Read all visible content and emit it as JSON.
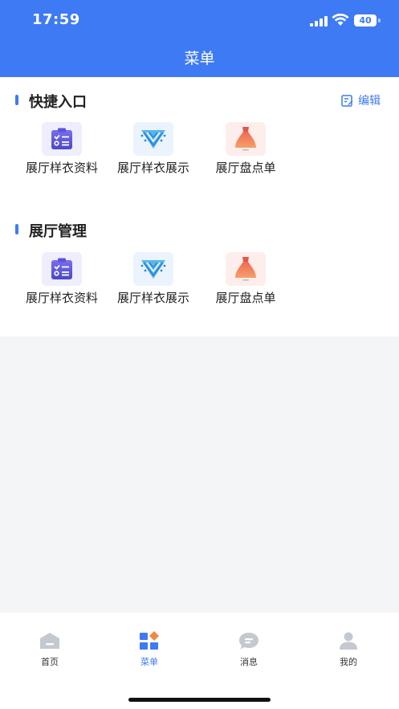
{
  "status_bar": {
    "time": "17:59",
    "battery": "40"
  },
  "nav": {
    "title": "菜单"
  },
  "quick_access": {
    "title": "快捷入口",
    "edit_label": "编辑",
    "items": [
      {
        "label": "展厅样衣资料",
        "icon": "clipboard-icon"
      },
      {
        "label": "展厅样衣展示",
        "icon": "garment-collar-icon"
      },
      {
        "label": "展厅盘点单",
        "icon": "dress-icon"
      }
    ]
  },
  "showroom_management": {
    "title": "展厅管理",
    "items": [
      {
        "label": "展厅样衣资料",
        "icon": "clipboard-icon"
      },
      {
        "label": "展厅样衣展示",
        "icon": "garment-collar-icon"
      },
      {
        "label": "展厅盘点单",
        "icon": "dress-icon"
      }
    ]
  },
  "tabbar": {
    "active": "菜单",
    "items": [
      {
        "label": "首页",
        "icon": "home-icon"
      },
      {
        "label": "菜单",
        "icon": "menu-grid-icon"
      },
      {
        "label": "消息",
        "icon": "message-icon"
      },
      {
        "label": "我的",
        "icon": "profile-icon"
      }
    ]
  },
  "colors": {
    "primary": "#3e7af4",
    "background": "#f4f5f7",
    "accent_orange": "#f08a3c"
  }
}
